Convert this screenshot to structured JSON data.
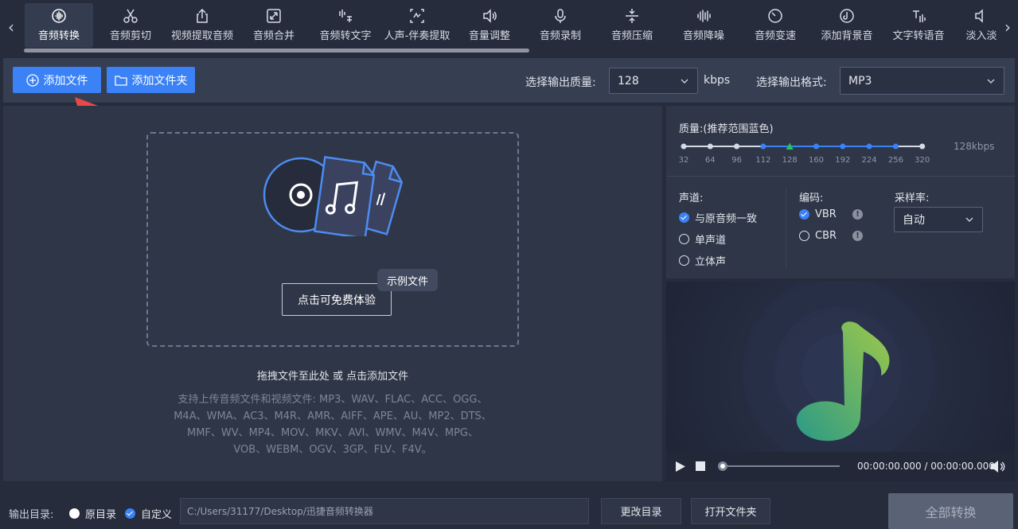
{
  "nav": {
    "tabs": [
      {
        "label": "音频转换",
        "icon": "audio-wave-icon"
      },
      {
        "label": "音频剪切",
        "icon": "scissors-icon"
      },
      {
        "label": "视频提取音频",
        "icon": "share-upload-icon"
      },
      {
        "label": "音频合并",
        "icon": "merge-icon"
      },
      {
        "label": "音频转文字",
        "icon": "voice-text-icon"
      },
      {
        "label": "人声-伴奏提取",
        "icon": "vocal-extract-icon"
      },
      {
        "label": "音量调整",
        "icon": "volume-adjust-icon"
      },
      {
        "label": "音频录制",
        "icon": "microphone-icon"
      },
      {
        "label": "音频压缩",
        "icon": "compress-icon"
      },
      {
        "label": "音频降噪",
        "icon": "noise-reduce-icon"
      },
      {
        "label": "音频变速",
        "icon": "speed-icon"
      },
      {
        "label": "添加背景音",
        "icon": "background-music-icon"
      },
      {
        "label": "文字转语音",
        "icon": "text-to-speech-icon"
      },
      {
        "label": "淡入淡",
        "icon": "fade-icon"
      }
    ]
  },
  "toolbar": {
    "add_file": "添加文件",
    "add_folder": "添加文件夹",
    "quality_label": "选择输出质量:",
    "quality_value": "128",
    "quality_unit": "kbps",
    "format_label": "选择输出格式:",
    "format_value": "MP3"
  },
  "drop": {
    "try_button": "点击可免费体验",
    "sample_tip": "示例文件",
    "hint": "拖拽文件至此处 或 点击添加文件",
    "formats_lines": [
      "支持上传音频文件和视频文件: MP3、WAV、FLAC、ACC、OGG、",
      "M4A、WMA、AC3、M4R、AMR、AIFF、APE、AU、MP2、DTS、",
      "MMF、WV、MP4、MOV、MKV、AVI、WMV、M4V、MPG、",
      "VOB、WEBM、OGV、3GP、FLV、F4V。"
    ]
  },
  "quality": {
    "title": "质量:(推荐范围蓝色)",
    "rate_text": "128kbps",
    "ticks": [
      "32",
      "64",
      "96",
      "112",
      "128",
      "160",
      "192",
      "224",
      "256",
      "320"
    ],
    "selected": "128",
    "colors": {
      "recommended": "#3b82f6",
      "selected": "#22c55e",
      "normal": "#d5dae5"
    }
  },
  "settings": {
    "channel_label": "声道:",
    "channel_options": [
      "与原音频一致",
      "单声道",
      "立体声"
    ],
    "channel_selected": "与原音频一致",
    "encoding_label": "编码:",
    "encoding_options": [
      "VBR",
      "CBR"
    ],
    "encoding_selected": "VBR",
    "samplerate_label": "采样率:",
    "samplerate_value": "自动"
  },
  "player": {
    "time": "00:00:00.000 / 00:00:00.000",
    "progress": 0
  },
  "bottom": {
    "output_label": "输出目录:",
    "opt_original": "原目录",
    "opt_custom": "自定义",
    "output_selected": "自定义",
    "path": "C:/Users/31177/Desktop/迅捷音频转换器",
    "change_dir": "更改目录",
    "open_folder": "打开文件夹",
    "convert_all": "全部转换"
  },
  "colors": {
    "accent": "#3b82f6",
    "arrow": "#e8484a",
    "note_gradient_start": "#2a9a86",
    "note_gradient_end": "#9ec84a"
  }
}
